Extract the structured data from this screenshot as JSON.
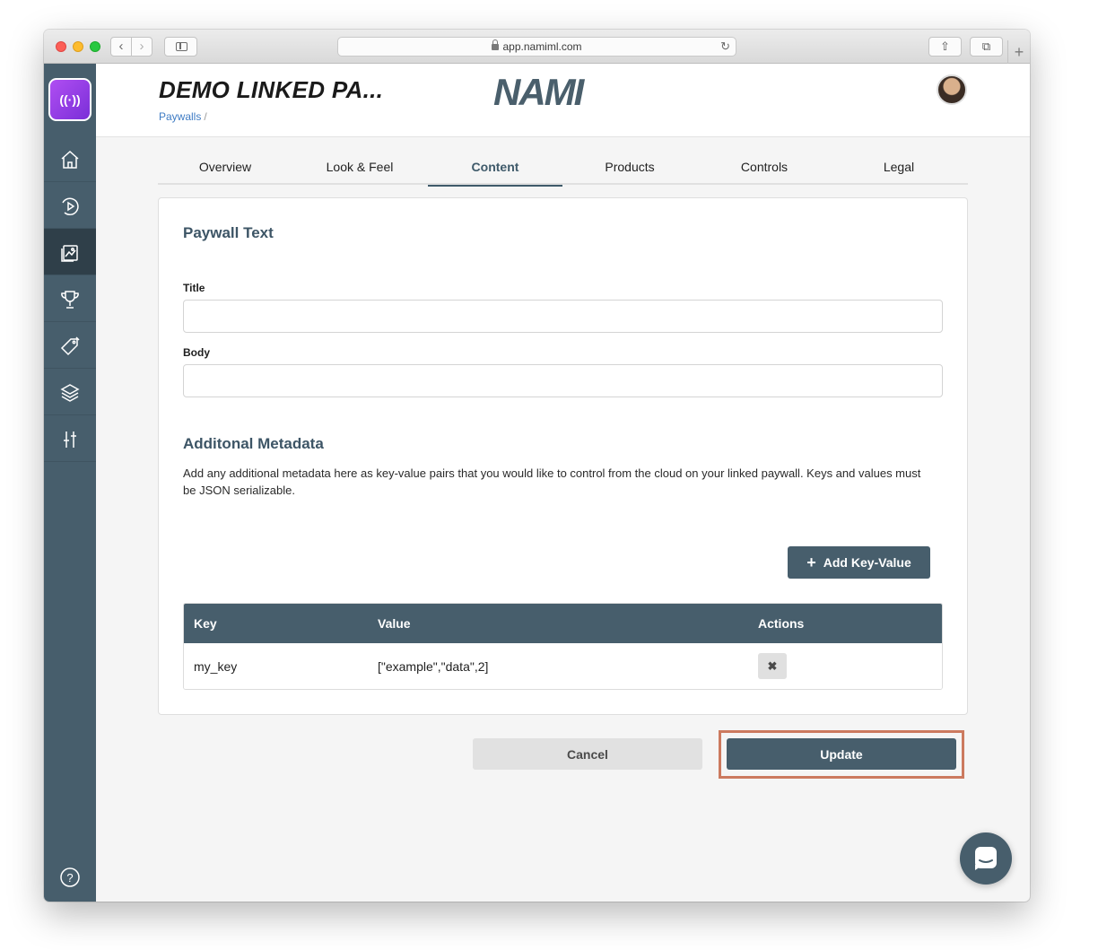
{
  "browser": {
    "url": "app.namiml.com",
    "back_glyph": "‹",
    "forward_glyph": "›",
    "reload_glyph": "↻",
    "share_glyph": "⇧",
    "tabs_glyph": "⧉",
    "new_tab_glyph": "+"
  },
  "app": {
    "logo_text": "((·))",
    "brand_logo_text": "NAMI",
    "accent_color": "#475e6c",
    "highlight_color": "#cc7a5f"
  },
  "sidebar": {
    "items": [
      {
        "icon": "home-icon",
        "active": false
      },
      {
        "icon": "play-icon",
        "active": false
      },
      {
        "icon": "paywall-gallery-icon",
        "active": true
      },
      {
        "icon": "trophy-icon",
        "active": false
      },
      {
        "icon": "tag-icon",
        "active": false
      },
      {
        "icon": "layers-icon",
        "active": false
      },
      {
        "icon": "sliders-icon",
        "active": false
      }
    ],
    "help_glyph": "?"
  },
  "header": {
    "title": "DEMO LINKED PA...",
    "breadcrumb": "Paywalls",
    "breadcrumb_sep": "/"
  },
  "tabs": [
    "Overview",
    "Look & Feel",
    "Content",
    "Products",
    "Controls",
    "Legal"
  ],
  "active_tab": "Content",
  "paywall_text": {
    "heading": "Paywall Text",
    "title_label": "Title",
    "title_value": "",
    "body_label": "Body",
    "body_value": ""
  },
  "metadata": {
    "heading": "Additonal Metadata",
    "description": "Add any additional metadata here as key-value pairs that you would like to control from the cloud on your linked paywall. Keys and values must be JSON serializable.",
    "add_button": "Add Key-Value",
    "add_glyph": "+",
    "columns": [
      "Key",
      "Value",
      "Actions"
    ],
    "rows": [
      {
        "key": "my_key",
        "value": "[\"example\",\"data\",2]",
        "delete_glyph": "✖"
      }
    ]
  },
  "actions": {
    "cancel": "Cancel",
    "update": "Update"
  }
}
